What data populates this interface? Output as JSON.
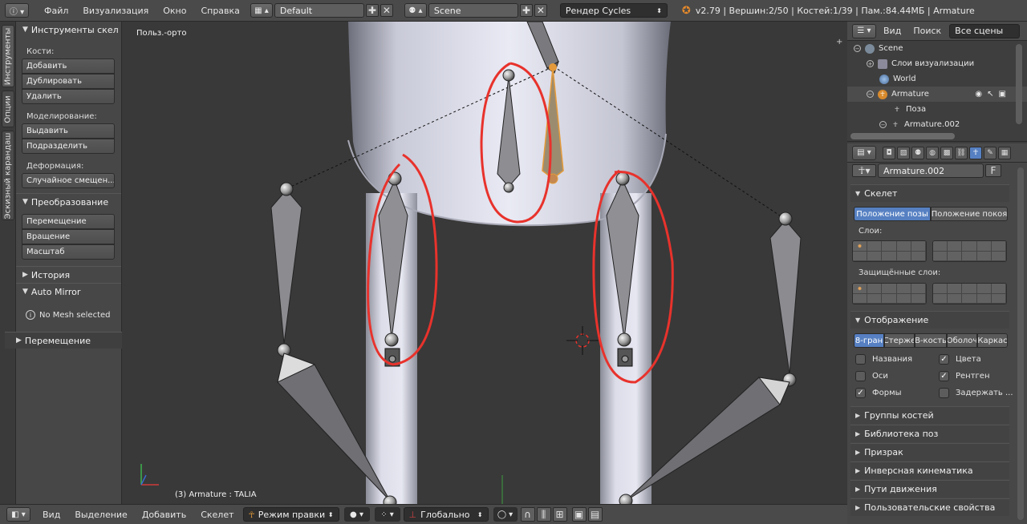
{
  "topbar": {
    "menus": [
      "Файл",
      "Визуализация",
      "Окно",
      "Справка"
    ],
    "layout_name": "Default",
    "scene_name": "Scene",
    "render_engine": "Рендер Cycles",
    "stats": "v2.79 | Вершин:2/50 | Костей:1/39 | Пам.:84.44МБ | Armature"
  },
  "left_tabs": [
    "Инструменты",
    "Опции",
    "Эскизный карандаш"
  ],
  "toolshelf": {
    "tools_header": "Инструменты скел",
    "bones_label": "Кости:",
    "bones_buttons": [
      "Добавить",
      "Дублировать",
      "Удалить"
    ],
    "modeling_label": "Моделирование:",
    "modeling_buttons": [
      "Выдавить",
      "Подразделить"
    ],
    "deform_label": "Деформация:",
    "deform_buttons": [
      "Случайное смещен..."
    ],
    "transform_header": "Преобразование",
    "transform_buttons": [
      "Перемещение",
      "Вращение",
      "Масштаб"
    ],
    "history_header": "История",
    "automirror_header": "Auto Mirror",
    "automirror_info": "No Mesh selected",
    "operator_header": "Перемещение"
  },
  "viewport": {
    "view_label": "Польз.-орто",
    "object_info": "(3) Armature : TALIA"
  },
  "outliner": {
    "menus": [
      "Вид",
      "Поиск"
    ],
    "filter": "Все сцены",
    "items": [
      {
        "label": "Scene"
      },
      {
        "label": "Слои визуализации"
      },
      {
        "label": "World"
      },
      {
        "label": "Armature"
      },
      {
        "label": "Поза"
      },
      {
        "label": "Armature.002"
      }
    ]
  },
  "properties": {
    "datablock_name": "Armature.002",
    "fake_user": "F",
    "skeleton_header": "Скелет",
    "pose_position": "Положение позы",
    "rest_position": "Положение покоя",
    "layers_label": "Слои:",
    "protected_label": "Защищённые слои:",
    "display_header": "Отображение",
    "display_modes": [
      "8-гран",
      "Стерже",
      "В-кость",
      "Оболоч",
      "Каркас"
    ],
    "checkboxes": [
      {
        "label": "Названия",
        "checked": false
      },
      {
        "label": "Цвета",
        "checked": true
      },
      {
        "label": "Оси",
        "checked": false
      },
      {
        "label": "Рентген",
        "checked": true
      },
      {
        "label": "Формы",
        "checked": true
      },
      {
        "label": "Задержать ...",
        "checked": false
      }
    ],
    "collapsed_sections": [
      "Группы костей",
      "Библиотека поз",
      "Призрак",
      "Инверсная кинематика",
      "Пути движения",
      "Пользовательские свойства"
    ]
  },
  "bottombar": {
    "menus": [
      "Вид",
      "Выделение",
      "Добавить",
      "Скелет"
    ],
    "mode": "Режим правки",
    "orientation": "Глобально"
  },
  "colors": {
    "annotation_red": "#e8322c",
    "selection_orange": "#e49a3a",
    "active_blue": "#5680c2"
  }
}
